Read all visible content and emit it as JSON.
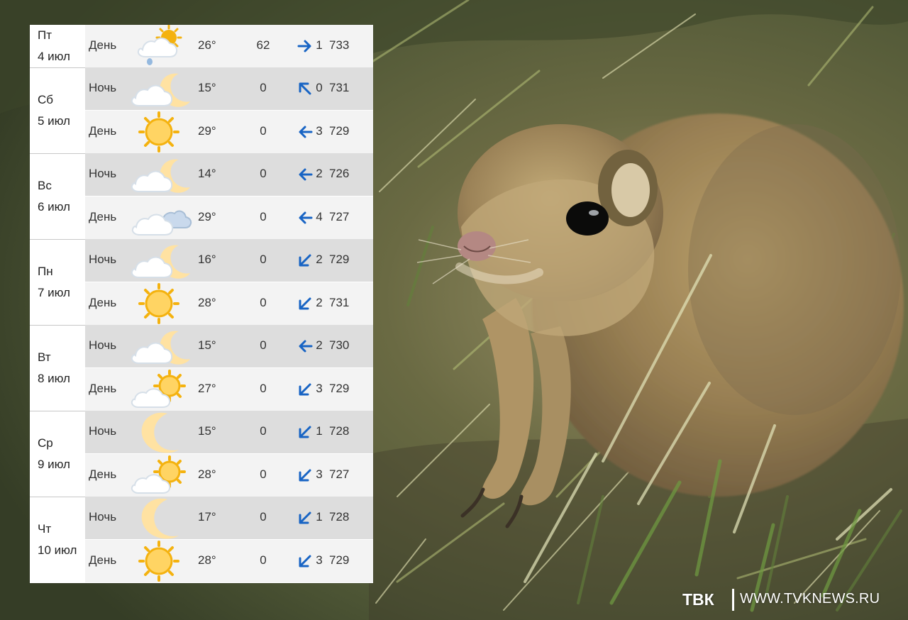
{
  "forecast": {
    "days": [
      {
        "weekday": "Пт",
        "date": "4 июл",
        "periods": [
          {
            "period": "День",
            "icon": "cloud-sun-rain-icon",
            "temperature": "26°",
            "precipitation": "62",
            "wind_direction": "east",
            "wind_speed": "1",
            "pressure": "733"
          }
        ]
      },
      {
        "weekday": "Сб",
        "date": "5 июл",
        "periods": [
          {
            "period": "Ночь",
            "icon": "cloud-moon-icon",
            "temperature": "15°",
            "precipitation": "0",
            "wind_direction": "northwest",
            "wind_speed": "0",
            "pressure": "731"
          },
          {
            "period": "День",
            "icon": "sun-icon",
            "temperature": "29°",
            "precipitation": "0",
            "wind_direction": "west",
            "wind_speed": "3",
            "pressure": "729"
          }
        ]
      },
      {
        "weekday": "Вс",
        "date": "6 июл",
        "periods": [
          {
            "period": "Ночь",
            "icon": "cloud-moon-icon",
            "temperature": "14°",
            "precipitation": "0",
            "wind_direction": "west",
            "wind_speed": "2",
            "pressure": "726"
          },
          {
            "period": "День",
            "icon": "cloudy-icon",
            "temperature": "29°",
            "precipitation": "0",
            "wind_direction": "west",
            "wind_speed": "4",
            "pressure": "727"
          }
        ]
      },
      {
        "weekday": "Пн",
        "date": "7 июл",
        "periods": [
          {
            "period": "Ночь",
            "icon": "cloud-moon-icon",
            "temperature": "16°",
            "precipitation": "0",
            "wind_direction": "southwest",
            "wind_speed": "2",
            "pressure": "729"
          },
          {
            "period": "День",
            "icon": "sun-icon",
            "temperature": "28°",
            "precipitation": "0",
            "wind_direction": "southwest",
            "wind_speed": "2",
            "pressure": "731"
          }
        ]
      },
      {
        "weekday": "Вт",
        "date": "8 июл",
        "periods": [
          {
            "period": "Ночь",
            "icon": "cloud-moon-icon",
            "temperature": "15°",
            "precipitation": "0",
            "wind_direction": "west",
            "wind_speed": "2",
            "pressure": "730"
          },
          {
            "period": "День",
            "icon": "sun-cloud-icon",
            "temperature": "27°",
            "precipitation": "0",
            "wind_direction": "southwest",
            "wind_speed": "3",
            "pressure": "729"
          }
        ]
      },
      {
        "weekday": "Ср",
        "date": "9 июл",
        "periods": [
          {
            "period": "Ночь",
            "icon": "moon-icon",
            "temperature": "15°",
            "precipitation": "0",
            "wind_direction": "southwest",
            "wind_speed": "1",
            "pressure": "728"
          },
          {
            "period": "День",
            "icon": "sun-cloud-icon",
            "temperature": "28°",
            "precipitation": "0",
            "wind_direction": "southwest",
            "wind_speed": "3",
            "pressure": "727"
          }
        ]
      },
      {
        "weekday": "Чт",
        "date": "10 июл",
        "periods": [
          {
            "period": "Ночь",
            "icon": "moon-icon",
            "temperature": "17°",
            "precipitation": "0",
            "wind_direction": "southwest",
            "wind_speed": "1",
            "pressure": "728"
          },
          {
            "period": "День",
            "icon": "sun-icon",
            "temperature": "28°",
            "precipitation": "0",
            "wind_direction": "southwest",
            "wind_speed": "3",
            "pressure": "729"
          }
        ]
      }
    ]
  },
  "watermark": {
    "brand": "ТВК",
    "url": "WWW.TVKNEWS.RU"
  },
  "colors": {
    "night_row": "#dddddd",
    "day_row": "#f3f3f3",
    "sun": "#f4b20f",
    "moon": "#ffe2a2",
    "cloud": "#ffffff",
    "wind_arrow": "#1864c4",
    "text": "#333333"
  }
}
